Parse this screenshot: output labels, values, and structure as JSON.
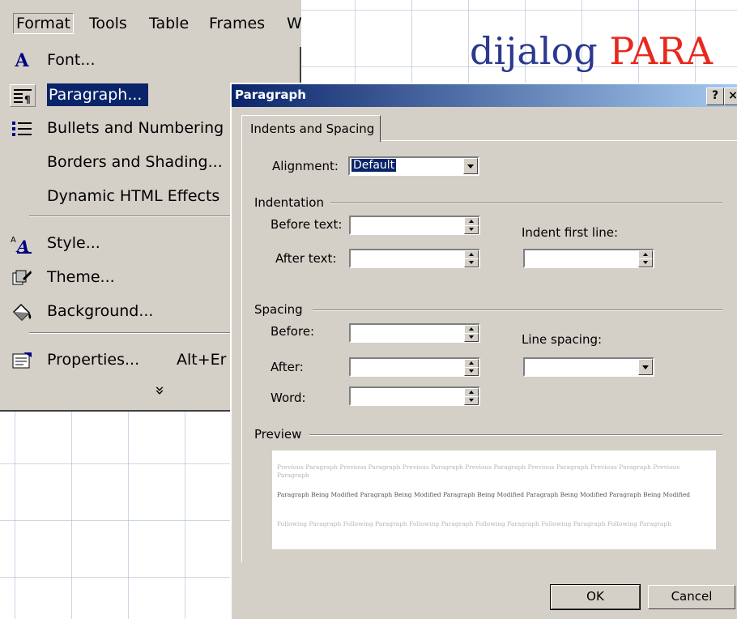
{
  "slide": {
    "title_main": "dijalog ",
    "title_accent": "PARA"
  },
  "menubar": {
    "items": [
      "Format",
      "Tools",
      "Table",
      "Frames",
      "W"
    ]
  },
  "menu": {
    "items": [
      {
        "label": "Font...",
        "icon": "font-A-icon"
      },
      {
        "label": "Paragraph...",
        "icon": "paragraph-icon",
        "highlighted": true
      },
      {
        "label": "Bullets and Numbering",
        "icon": "bullets-icon"
      },
      {
        "label": "Borders and Shading...",
        "icon": ""
      },
      {
        "label": "Dynamic HTML Effects",
        "icon": ""
      },
      {
        "label": "Style...",
        "icon": "style-icon"
      },
      {
        "label": "Theme...",
        "icon": "theme-icon"
      },
      {
        "label": "Background...",
        "icon": "paint-bucket-icon"
      },
      {
        "label": "Properties...",
        "shortcut": "Alt+Er",
        "icon": "properties-icon"
      }
    ],
    "expand_glyph": "»"
  },
  "dialog": {
    "title": "Paragraph",
    "help_btn": "?",
    "close_btn": "×",
    "tab": "Indents and Spacing",
    "alignment_label": "Alignment:",
    "alignment_value": "Default",
    "indentation_label": "Indentation",
    "before_text_label": "Before text:",
    "after_text_label": "After text:",
    "indent_first_line_label": "Indent first line:",
    "spacing_label": "Spacing",
    "before_label": "Before:",
    "after_label": "After:",
    "word_label": "Word:",
    "line_spacing_label": "Line spacing:",
    "preview_label": "Preview",
    "preview_prev": "Previous Paragraph Previous Paragraph Previous Paragraph Previous Paragraph Previous Paragraph Previous Paragraph Previous Paragraph",
    "preview_mod": "Paragraph Being Modified Paragraph Being Modified Paragraph Being Modified Paragraph Being Modified Paragraph Being Modified",
    "preview_next": "Following Paragraph Following Paragraph Following Paragraph Following Paragraph Following Paragraph Following Paragraph",
    "ok": "OK",
    "cancel": "Cancel"
  }
}
